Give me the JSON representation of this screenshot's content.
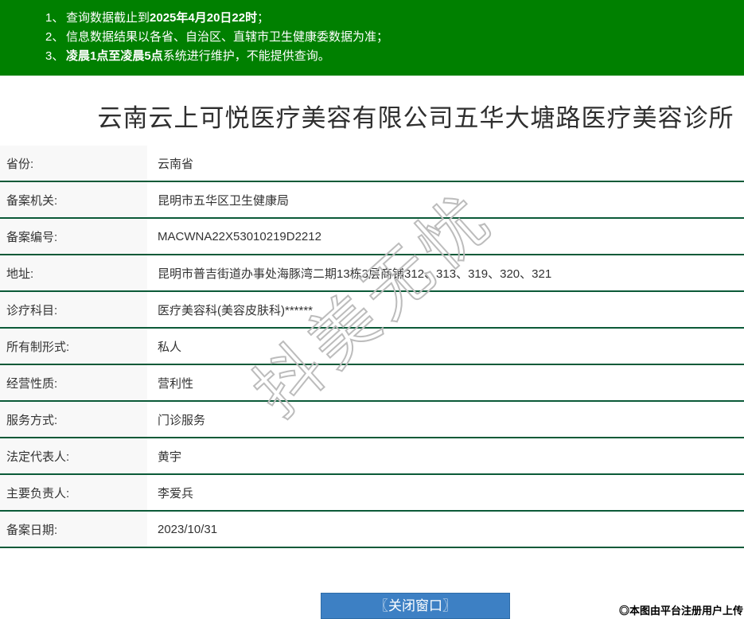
{
  "banner": {
    "lines": [
      {
        "num": "1、",
        "segments": [
          {
            "text": "查询数据截止到",
            "bold": false
          },
          {
            "text": "2025年4月20日22时",
            "bold": true
          },
          {
            "text": "；",
            "bold": false
          }
        ]
      },
      {
        "num": "2、",
        "segments": [
          {
            "text": "信息数据结果以各省、自治区、直辖市卫生健康委数据为准；",
            "bold": false
          }
        ]
      },
      {
        "num": "3、",
        "segments": [
          {
            "text": "凌晨1点至凌晨5点",
            "bold": true
          },
          {
            "text": "系统进行维护，不能提供查询。",
            "bold": false
          }
        ]
      }
    ]
  },
  "title": "云南云上可悦医疗美容有限公司五华大塘路医疗美容诊所",
  "table": {
    "rows": [
      {
        "label": "省份:",
        "value": "云南省"
      },
      {
        "label": "备案机关:",
        "value": "昆明市五华区卫生健康局"
      },
      {
        "label": "备案编号:",
        "value": "MACWNA22X53010219D2212"
      },
      {
        "label": "地址:",
        "value": "昆明市普吉街道办事处海豚湾二期13栋3层商铺312、313、319、320、321"
      },
      {
        "label": "诊疗科目:",
        "value": "医疗美容科(美容皮肤科)******"
      },
      {
        "label": "所有制形式:",
        "value": "私人"
      },
      {
        "label": "经营性质:",
        "value": "营利性"
      },
      {
        "label": "服务方式:",
        "value": "门诊服务"
      },
      {
        "label": "法定代表人:",
        "value": "黄宇"
      },
      {
        "label": "主要负责人:",
        "value": "李爱兵"
      },
      {
        "label": "备案日期:",
        "value": "2023/10/31"
      }
    ]
  },
  "close_button_label": "〖关闭窗口〗",
  "watermark_text": "抖美无忧",
  "credit_text": "◎本图由平台注册用户上传",
  "colors": {
    "banner_bg": "#008000",
    "divider": "#0b5a38",
    "label_bg": "#f8f8f8",
    "button_bg": "#3d80c4",
    "button_border": "#2e6ca8",
    "watermark_stroke": "#bcbcbc"
  }
}
